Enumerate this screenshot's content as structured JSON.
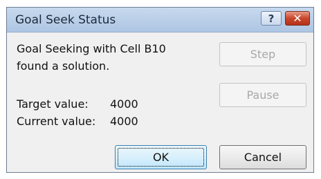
{
  "window": {
    "title": "Goal Seek Status",
    "help_glyph": "?",
    "close_glyph": "✕"
  },
  "status": {
    "line1": "Goal Seeking with Cell B10",
    "line2": "found a solution."
  },
  "values": {
    "target_label": "Target value:",
    "target_value": "4000",
    "current_label": "Current value:",
    "current_value": "4000"
  },
  "buttons": {
    "step": "Step",
    "pause": "Pause",
    "ok": "OK",
    "cancel": "Cancel"
  },
  "colors": {
    "titlebar": "#b9cee8",
    "close_button": "#c9462a",
    "dialog_bg": "#f0f0f0"
  }
}
